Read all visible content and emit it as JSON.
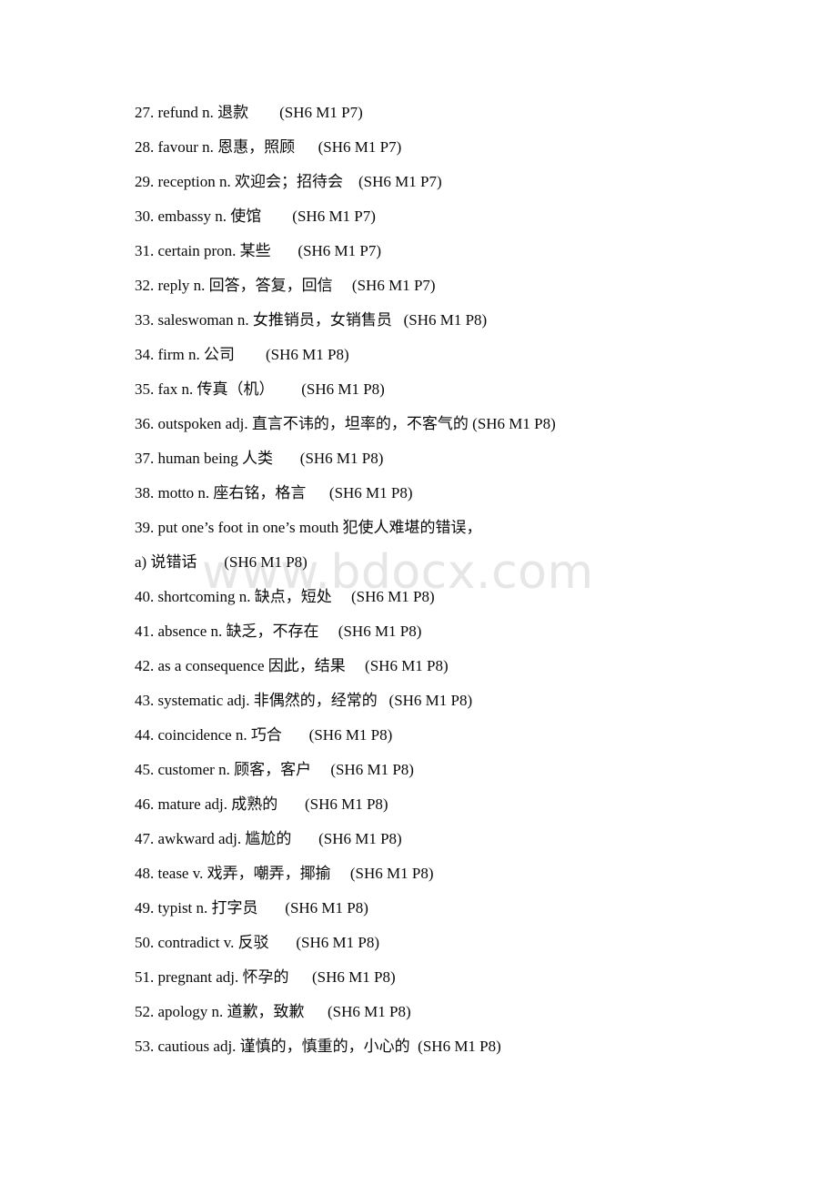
{
  "page": {
    "background_color": "#ffffff",
    "text_color": "#000000"
  },
  "watermark": {
    "text": "www.bdocx.com",
    "color": "#e6e6e6"
  },
  "vocabulary_list": {
    "lines": [
      {
        "number": "27.",
        "term": "refund",
        "pos": "n.",
        "definition": "退款",
        "gap": "        ",
        "reference": "(SH6 M1 P7)",
        "text": "27. refund n. 退款        (SH6 M1 P7)"
      },
      {
        "number": "28.",
        "term": "favour",
        "pos": "n.",
        "definition": "恩惠，照顾",
        "gap": "      ",
        "reference": "(SH6 M1 P7)",
        "text": "28. favour n. 恩惠，照顾      (SH6 M1 P7)"
      },
      {
        "number": "29.",
        "term": "reception",
        "pos": "n.",
        "definition": "欢迎会；招待会",
        "gap": "    ",
        "reference": "(SH6 M1 P7)",
        "text": "29. reception n. 欢迎会；招待会    (SH6 M1 P7)"
      },
      {
        "number": "30.",
        "term": "embassy",
        "pos": "n.",
        "definition": "使馆",
        "gap": "        ",
        "reference": "(SH6 M1 P7)",
        "text": "30. embassy n. 使馆        (SH6 M1 P7)"
      },
      {
        "number": "31.",
        "term": "certain",
        "pos": "pron.",
        "definition": "某些",
        "gap": "       ",
        "reference": "(SH6 M1 P7)",
        "text": "31. certain pron. 某些       (SH6 M1 P7)"
      },
      {
        "number": "32.",
        "term": "reply",
        "pos": "n.",
        "definition": "回答，答复，回信",
        "gap": "     ",
        "reference": "(SH6 M1 P7)",
        "text": "32. reply n. 回答，答复，回信     (SH6 M1 P7)"
      },
      {
        "number": "33.",
        "term": "saleswoman",
        "pos": "n.",
        "definition": "女推销员，女销售员",
        "gap": "   ",
        "reference": "(SH6 M1 P8)",
        "text": "33. saleswoman n. 女推销员，女销售员   (SH6 M1 P8)"
      },
      {
        "number": "34.",
        "term": "firm",
        "pos": "n.",
        "definition": "公司",
        "gap": "        ",
        "reference": "(SH6 M1 P8)",
        "text": "34. firm n. 公司        (SH6 M1 P8)"
      },
      {
        "number": "35.",
        "term": "fax",
        "pos": "n.",
        "definition": "传真（机）",
        "gap": "       ",
        "reference": "(SH6 M1 P8)",
        "text": "35. fax n. 传真（机）       (SH6 M1 P8)"
      },
      {
        "number": "36.",
        "term": "outspoken",
        "pos": "adj.",
        "definition": "直言不讳的，坦率的，不客气的",
        "gap": " ",
        "reference": "(SH6 M1 P8)",
        "text": "36. outspoken adj. 直言不讳的，坦率的，不客气的 (SH6 M1 P8)"
      },
      {
        "number": "37.",
        "term": "human being",
        "pos": "",
        "definition": "人类",
        "gap": "       ",
        "reference": "(SH6 M1 P8)",
        "text": "37. human being 人类       (SH6 M1 P8)"
      },
      {
        "number": "38.",
        "term": "motto",
        "pos": "n.",
        "definition": "座右铭，格言",
        "gap": "      ",
        "reference": "(SH6 M1 P8)",
        "text": "38. motto n. 座右铭，格言      (SH6 M1 P8)"
      },
      {
        "number": "39.",
        "term": "put one’s foot in one’s mouth",
        "pos": "",
        "definition": "犯使人难堪的错误，",
        "gap": "",
        "reference": "",
        "text": "39. put one’s foot in one’s mouth 犯使人难堪的错误，"
      },
      {
        "number": "a)",
        "term": "",
        "pos": "",
        "definition": "说错话",
        "gap": "       ",
        "reference": "(SH6 M1 P8)",
        "text": "a) 说错话       (SH6 M1 P8)"
      },
      {
        "number": "40.",
        "term": "shortcoming",
        "pos": "n.",
        "definition": "缺点，短处",
        "gap": "     ",
        "reference": "(SH6 M1 P8)",
        "text": "40. shortcoming n. 缺点，短处     (SH6 M1 P8)"
      },
      {
        "number": "41.",
        "term": "absence",
        "pos": "n.",
        "definition": "缺乏，不存在",
        "gap": "     ",
        "reference": "(SH6 M1 P8)",
        "text": "41. absence n. 缺乏，不存在     (SH6 M1 P8)"
      },
      {
        "number": "42.",
        "term": "as a consequence",
        "pos": "",
        "definition": "因此，结果",
        "gap": "     ",
        "reference": "(SH6 M1 P8)",
        "text": "42. as a consequence 因此，结果     (SH6 M1 P8)"
      },
      {
        "number": "43.",
        "term": "systematic",
        "pos": "adj.",
        "definition": "非偶然的，经常的",
        "gap": "   ",
        "reference": "(SH6 M1 P8)",
        "text": "43. systematic adj. 非偶然的，经常的   (SH6 M1 P8)"
      },
      {
        "number": "44.",
        "term": "coincidence",
        "pos": "n.",
        "definition": "巧合",
        "gap": "       ",
        "reference": "(SH6 M1 P8)",
        "text": "44. coincidence n. 巧合       (SH6 M1 P8)"
      },
      {
        "number": "45.",
        "term": "customer",
        "pos": "n.",
        "definition": "顾客，客户",
        "gap": "     ",
        "reference": "(SH6 M1 P8)",
        "text": "45. customer n. 顾客，客户     (SH6 M1 P8)"
      },
      {
        "number": "46.",
        "term": "mature",
        "pos": "adj.",
        "definition": "成熟的",
        "gap": "       ",
        "reference": "(SH6 M1 P8)",
        "text": "46. mature adj. 成熟的       (SH6 M1 P8)"
      },
      {
        "number": "47.",
        "term": "awkward",
        "pos": "adj.",
        "definition": "尴尬的",
        "gap": "       ",
        "reference": "(SH6 M1 P8)",
        "text": "47. awkward adj. 尴尬的       (SH6 M1 P8)"
      },
      {
        "number": "48.",
        "term": "tease",
        "pos": "v.",
        "definition": "戏弄，嘲弄，揶揄",
        "gap": "     ",
        "reference": "(SH6 M1 P8)",
        "text": "48. tease v. 戏弄，嘲弄，揶揄     (SH6 M1 P8)"
      },
      {
        "number": "49.",
        "term": "typist",
        "pos": "n.",
        "definition": "打字员",
        "gap": "       ",
        "reference": "(SH6 M1 P8)",
        "text": "49. typist n. 打字员       (SH6 M1 P8)"
      },
      {
        "number": "50.",
        "term": "contradict",
        "pos": "v.",
        "definition": "反驳",
        "gap": "       ",
        "reference": "(SH6 M1 P8)",
        "text": "50. contradict v. 反驳       (SH6 M1 P8)"
      },
      {
        "number": "51.",
        "term": "pregnant",
        "pos": "adj.",
        "definition": "怀孕的",
        "gap": "      ",
        "reference": "(SH6 M1 P8)",
        "text": "51. pregnant adj. 怀孕的      (SH6 M1 P8)"
      },
      {
        "number": "52.",
        "term": "apology",
        "pos": "n.",
        "definition": "道歉，致歉",
        "gap": "      ",
        "reference": "(SH6 M1 P8)",
        "text": "52. apology n. 道歉，致歉      (SH6 M1 P8)"
      },
      {
        "number": "53.",
        "term": "cautious",
        "pos": "adj.",
        "definition": "谨慎的，慎重的，小心的",
        "gap": "  ",
        "reference": "(SH6 M1 P8)",
        "text": "53. cautious adj. 谨慎的，慎重的，小心的  (SH6 M1 P8)"
      }
    ]
  }
}
